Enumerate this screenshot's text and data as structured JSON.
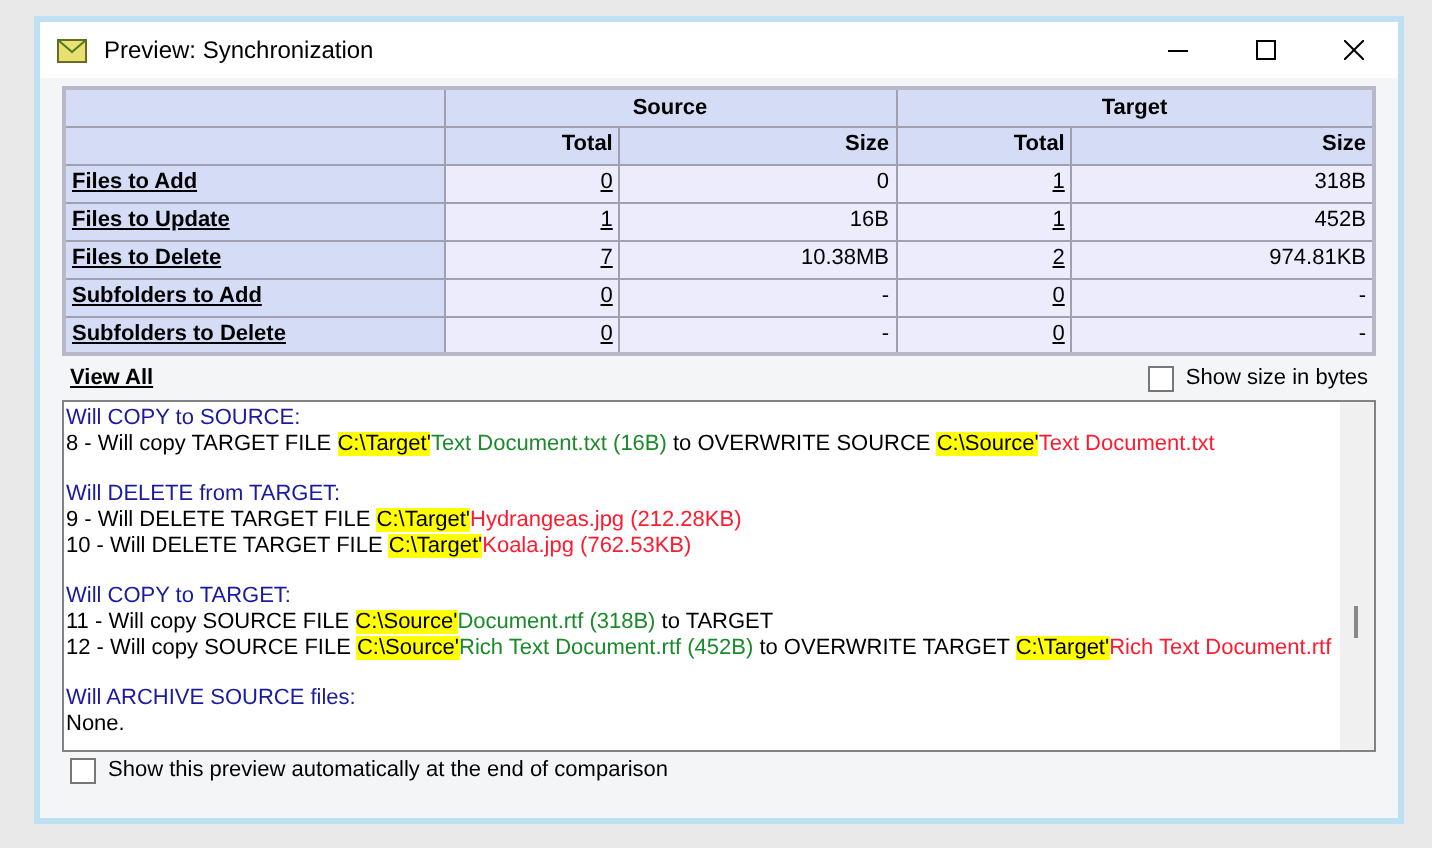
{
  "window": {
    "title": "Preview: Synchronization"
  },
  "table": {
    "groups": [
      "Source",
      "Target"
    ],
    "columns": [
      "Total",
      "Size",
      "Total",
      "Size"
    ],
    "rows": [
      {
        "label": "Files to Add",
        "cells": [
          "0",
          "0",
          "1",
          "318B"
        ]
      },
      {
        "label": "Files to Update",
        "cells": [
          "1",
          "16B",
          "1",
          "452B"
        ]
      },
      {
        "label": "Files to Delete",
        "cells": [
          "7",
          "10.38MB",
          "2",
          "974.81KB"
        ]
      },
      {
        "label": "Subfolders to Add",
        "cells": [
          "0",
          "-",
          "0",
          "-"
        ]
      },
      {
        "label": "Subfolders to Delete",
        "cells": [
          "0",
          "-",
          "0",
          "-"
        ]
      }
    ]
  },
  "view_all": "View All",
  "show_size": {
    "label": "Show size in bytes",
    "checked": false
  },
  "log": [
    {
      "heading": "Will COPY to SOURCE:",
      "lines": [
        [
          {
            "kind": "plain",
            "text": "8 - Will copy TARGET FILE "
          },
          {
            "kind": "path",
            "text": "C:\\Target'"
          },
          {
            "kind": "green",
            "text": "Text Document.txt (16B)"
          },
          {
            "kind": "plain",
            "text": " to OVERWRITE SOURCE "
          },
          {
            "kind": "path",
            "text": "C:\\Source'"
          },
          {
            "kind": "red",
            "text": "Text Document.txt"
          }
        ]
      ]
    },
    {
      "heading": "Will DELETE from TARGET:",
      "lines": [
        [
          {
            "kind": "plain",
            "text": "9 - Will DELETE TARGET FILE "
          },
          {
            "kind": "path",
            "text": "C:\\Target'"
          },
          {
            "kind": "red",
            "text": "Hydrangeas.jpg (212.28KB)"
          }
        ],
        [
          {
            "kind": "plain",
            "text": "10 - Will DELETE TARGET FILE "
          },
          {
            "kind": "path",
            "text": "C:\\Target'"
          },
          {
            "kind": "red",
            "text": "Koala.jpg (762.53KB)"
          }
        ]
      ]
    },
    {
      "heading": "Will COPY to TARGET:",
      "lines": [
        [
          {
            "kind": "plain",
            "text": "11 - Will copy SOURCE FILE "
          },
          {
            "kind": "path",
            "text": "C:\\Source'"
          },
          {
            "kind": "green",
            "text": "Document.rtf (318B)"
          },
          {
            "kind": "plain",
            "text": " to TARGET"
          }
        ],
        [
          {
            "kind": "plain",
            "text": "12 - Will copy SOURCE FILE "
          },
          {
            "kind": "path",
            "text": "C:\\Source'"
          },
          {
            "kind": "green",
            "text": "Rich Text Document.rtf (452B)"
          },
          {
            "kind": "plain",
            "text": " to OVERWRITE TARGET "
          },
          {
            "kind": "path",
            "text": "C:\\Target'"
          },
          {
            "kind": "red",
            "text": "Rich Text Document.rtf"
          }
        ]
      ]
    },
    {
      "heading": "Will ARCHIVE SOURCE files:",
      "lines": [
        [
          {
            "kind": "plain",
            "text": "None."
          }
        ]
      ]
    }
  ],
  "auto_preview": {
    "label": "Show this preview automatically at the end of comparison",
    "checked": false
  }
}
